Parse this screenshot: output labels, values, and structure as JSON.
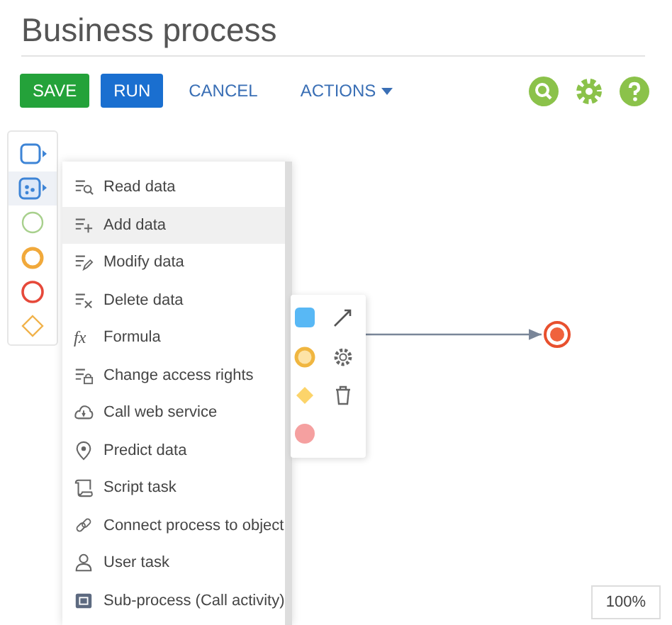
{
  "title": "Business process",
  "toolbar": {
    "buttons": [
      {
        "label": "SAVE",
        "kind": "save"
      },
      {
        "label": "RUN",
        "kind": "run"
      },
      {
        "label": "CANCEL",
        "kind": "link"
      },
      {
        "label": "ACTIONS",
        "kind": "dropdown"
      }
    ]
  },
  "palette": {
    "items": [
      {
        "kind": "task",
        "selected": false
      },
      {
        "kind": "script",
        "selected": true
      },
      {
        "kind": "start",
        "selected": false
      },
      {
        "kind": "intermediate",
        "selected": false
      },
      {
        "kind": "end",
        "selected": false
      },
      {
        "kind": "gateway",
        "selected": false
      }
    ]
  },
  "menu": {
    "items": [
      {
        "label": "Read data",
        "kind": "read",
        "selected": false
      },
      {
        "label": "Add data",
        "kind": "add",
        "selected": true
      },
      {
        "label": "Modify data",
        "kind": "modify",
        "selected": false
      },
      {
        "label": "Delete data",
        "kind": "delete",
        "selected": false
      },
      {
        "label": "Formula",
        "kind": "formula",
        "symbol": "fx",
        "selected": false
      },
      {
        "label": "Change access rights",
        "kind": "access",
        "selected": false
      },
      {
        "label": "Call web service",
        "kind": "web",
        "selected": false
      },
      {
        "label": "Predict data",
        "kind": "predict",
        "selected": false
      },
      {
        "label": "Script task",
        "kind": "script",
        "selected": false
      },
      {
        "label": "Connect process to object",
        "kind": "connect",
        "selected": false
      },
      {
        "label": "User task",
        "kind": "user",
        "selected": false
      },
      {
        "label": "Sub-process (Call activity)",
        "kind": "subprocess",
        "selected": false
      }
    ]
  },
  "zoom": "100%"
}
